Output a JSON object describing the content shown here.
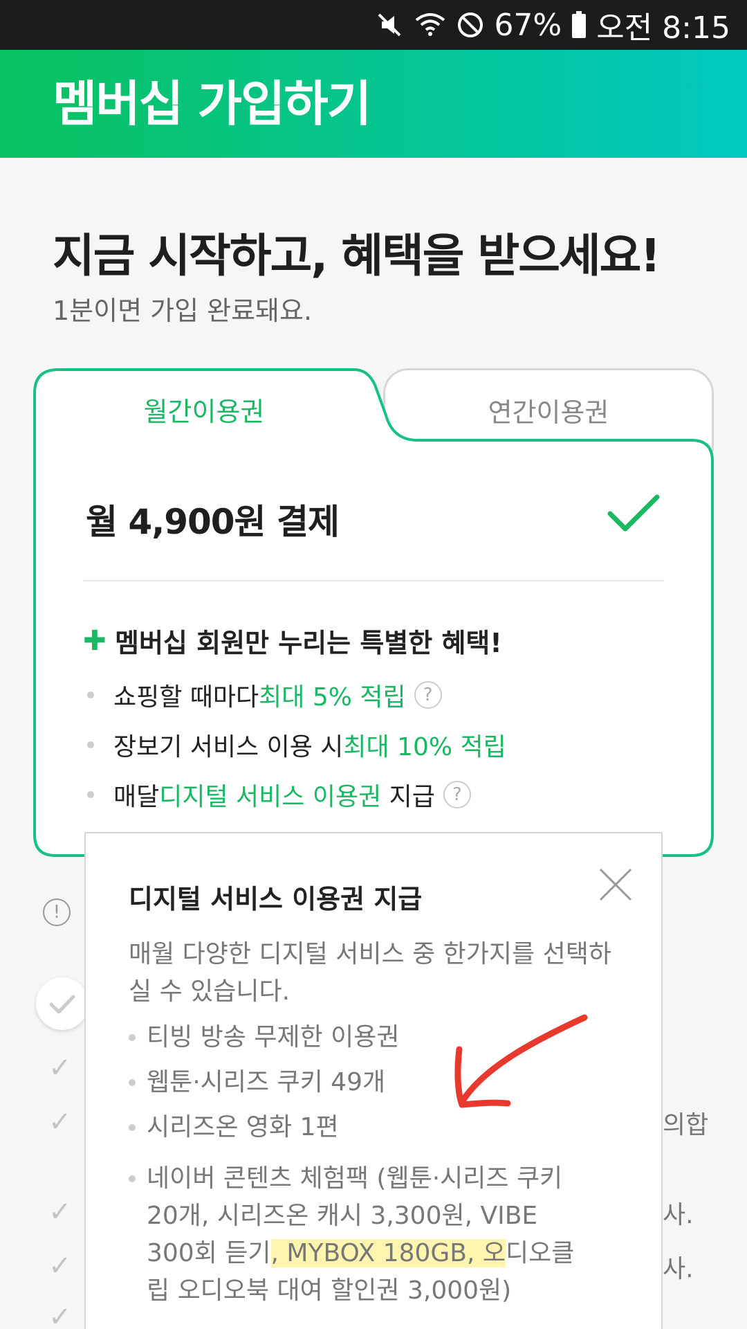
{
  "status_bar": {
    "battery": "67%",
    "time": "오전 8:15",
    "icons": [
      "mute-icon",
      "wifi-icon",
      "do-not-disturb-icon",
      "battery-icon"
    ]
  },
  "header": {
    "title": "멤버십 가입하기"
  },
  "intro": {
    "headline": "지금 시작하고, 혜택을 받으세요!",
    "subline": "1분이면 가입 완료돼요."
  },
  "tabs": [
    {
      "label": "월간이용권",
      "active": true
    },
    {
      "label": "연간이용권",
      "active": false
    }
  ],
  "plan": {
    "price_text": "월 4,900원 결제",
    "benefit_title": "멤버십 회원만 누리는 특별한 혜택!",
    "benefits": [
      {
        "prefix": "쇼핑할 때마다 ",
        "highlight": "최대 5% 적립",
        "suffix": "",
        "help": "?"
      },
      {
        "prefix": "장보기 서비스 이용 시 ",
        "highlight": "최대 10% 적립",
        "suffix": "",
        "help": ""
      },
      {
        "prefix": "매달 ",
        "highlight": "디지털 서비스 이용권",
        "suffix": " 지급",
        "help": "?"
      }
    ]
  },
  "background": {
    "info_icon": "!",
    "partial_texts": [
      "의합",
      "사.",
      "사."
    ]
  },
  "popup": {
    "title": "디지털 서비스 이용권 지급",
    "description": "매월 다양한 디지털 서비스 중 한가지를 선택하실 수 있습니다.",
    "items": [
      "티빙 방송 무제한 이용권",
      "웹툰·시리즈 쿠키 49개",
      "시리즈온 영화 1편"
    ],
    "last_item": {
      "before": "네이버 콘텐츠 체험팩 (웹툰·시리즈 쿠키 20개, 시리즈온 캐시 3,300원, VIBE 300회 듣기",
      "highlight": ", MYBOX 180GB, 오",
      "after": "디오클립 오디오북 대여 할인권 3,000원)"
    }
  },
  "colors": {
    "accent_green": "#1bb863",
    "header_gradient_start": "#09c15f",
    "header_gradient_end": "#00c9bf",
    "annotation_arrow": "#e8392e",
    "highlight": "#ffec6e"
  }
}
